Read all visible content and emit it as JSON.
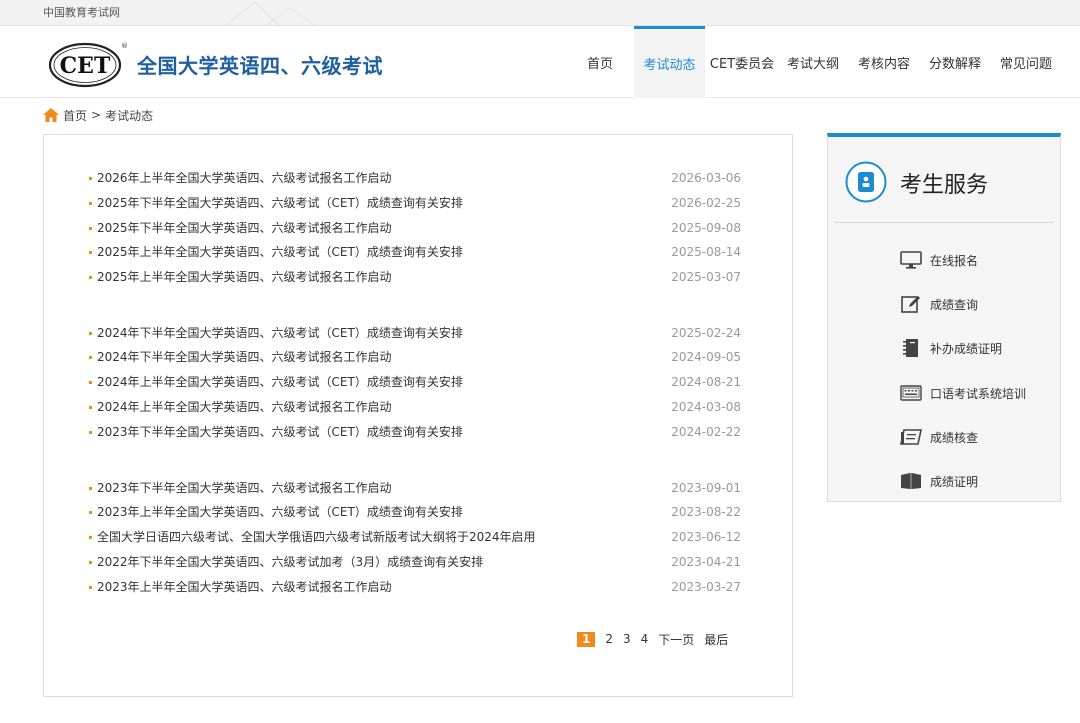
{
  "topbar": {
    "site_link": "中国教育考试网"
  },
  "header": {
    "logo_text": "CET",
    "logo_mark": "®",
    "site_title": "全国大学英语四、六级考试"
  },
  "nav": {
    "items": [
      {
        "label": "首页"
      },
      {
        "label": "考试动态",
        "active": true
      },
      {
        "label": "CET委员会"
      },
      {
        "label": "考试大纲"
      },
      {
        "label": "考核内容"
      },
      {
        "label": "分数解释"
      },
      {
        "label": "常见问题"
      }
    ]
  },
  "breadcrumb": {
    "home": "首页",
    "separator": ">",
    "current": "考试动态"
  },
  "news": {
    "items": [
      {
        "title": "2026年上半年全国大学英语四、六级考试报名工作启动",
        "date": "2026-03-06"
      },
      {
        "title": "2025年下半年全国大学英语四、六级考试（CET）成绩查询有关安排",
        "date": "2026-02-25"
      },
      {
        "title": "2025年下半年全国大学英语四、六级考试报名工作启动",
        "date": "2025-09-08"
      },
      {
        "title": "2025年上半年全国大学英语四、六级考试（CET）成绩查询有关安排",
        "date": "2025-08-14"
      },
      {
        "title": "2025年上半年全国大学英语四、六级考试报名工作启动",
        "date": "2025-03-07"
      },
      {
        "title": "2024年下半年全国大学英语四、六级考试（CET）成绩查询有关安排",
        "date": "2025-02-24"
      },
      {
        "title": "2024年下半年全国大学英语四、六级考试报名工作启动",
        "date": "2024-09-05"
      },
      {
        "title": "2024年上半年全国大学英语四、六级考试（CET）成绩查询有关安排",
        "date": "2024-08-21"
      },
      {
        "title": "2024年上半年全国大学英语四、六级考试报名工作启动",
        "date": "2024-03-08"
      },
      {
        "title": "2023年下半年全国大学英语四、六级考试（CET）成绩查询有关安排",
        "date": "2024-02-22"
      },
      {
        "title": "2023年下半年全国大学英语四、六级考试报名工作启动",
        "date": "2023-09-01"
      },
      {
        "title": "2023年上半年全国大学英语四、六级考试（CET）成绩查询有关安排",
        "date": "2023-08-22"
      },
      {
        "title": "全国大学日语四六级考试、全国大学俄语四六级考试新版考试大纲将于2024年启用",
        "date": "2023-06-12"
      },
      {
        "title": "2022年下半年全国大学英语四、六级考试加考（3月）成绩查询有关安排",
        "date": "2023-04-21"
      },
      {
        "title": "2023年上半年全国大学英语四、六级考试报名工作启动",
        "date": "2023-03-27"
      }
    ]
  },
  "pagination": {
    "pages": [
      "1",
      "2",
      "3",
      "4"
    ],
    "current": "1",
    "next": "下一页",
    "last": "最后"
  },
  "service": {
    "title": "考生服务",
    "items": [
      {
        "label": "在线报名",
        "icon": "monitor-icon"
      },
      {
        "label": "成绩查询",
        "icon": "edit-icon"
      },
      {
        "label": "补办成绩证明",
        "icon": "notebook-icon"
      },
      {
        "label": "口语考试系统培训",
        "icon": "keyboard-icon"
      },
      {
        "label": "成绩核查",
        "icon": "check-pen-icon"
      },
      {
        "label": "成绩证明",
        "icon": "book-icon"
      }
    ]
  },
  "colors": {
    "accent": "#1d8bd1",
    "title_blue": "#1f5fa0",
    "bullet_orange": "#f08a1c",
    "date_gray": "#999999"
  }
}
